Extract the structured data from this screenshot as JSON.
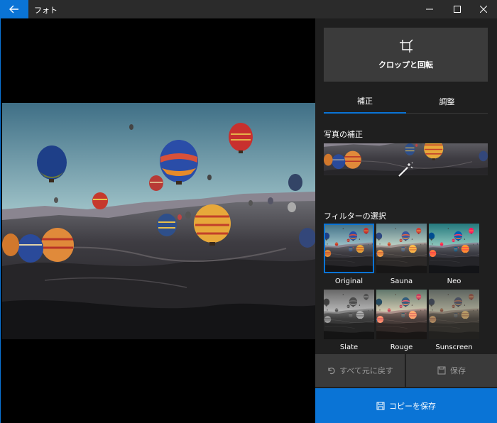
{
  "window": {
    "title": "フォト"
  },
  "panel": {
    "crop_label": "クロップと回転",
    "tabs": [
      {
        "label": "補正"
      },
      {
        "label": "調整"
      }
    ],
    "enhance_label": "写真の補正",
    "filters_label": "フィルターの選択",
    "filters": [
      {
        "label": "Original"
      },
      {
        "label": "Sauna"
      },
      {
        "label": "Neo"
      },
      {
        "label": "Slate"
      },
      {
        "label": "Rouge"
      },
      {
        "label": "Sunscreen"
      }
    ],
    "reset_label": "すべて元に戻す",
    "save_label": "保存",
    "save_copy_label": "コピーを保存"
  },
  "accent_color": "#0a74d6"
}
